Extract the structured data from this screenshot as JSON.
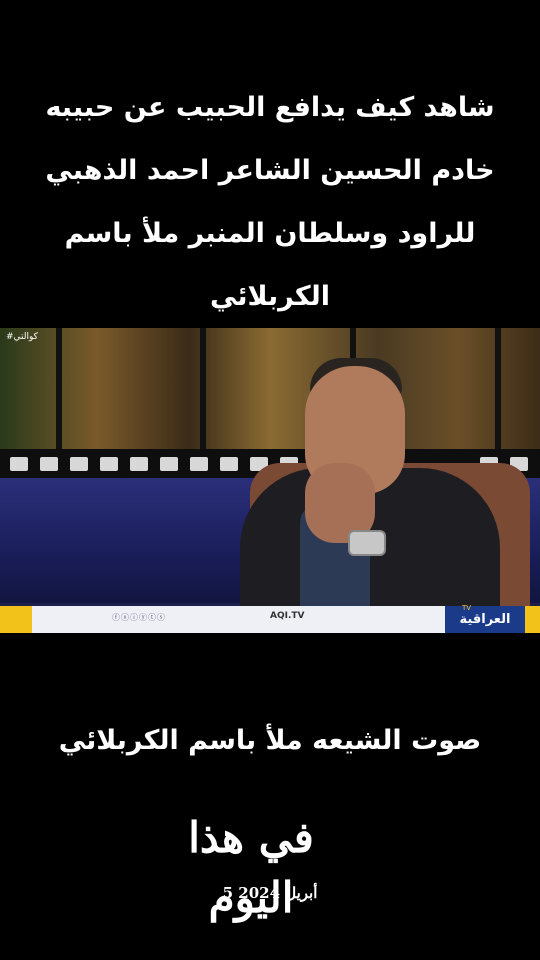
{
  "top_caption": {
    "lines": [
      "شاهد كيف يدافع الحبيب عن حبيبه",
      "خادم الحسين الشاعر احمد الذهبي",
      "للراود وسلطان المنبر ملأ باسم",
      "الكربلائي"
    ]
  },
  "video": {
    "tag": "#كوالتي",
    "ticker": {
      "url": "AQI.TV",
      "social": "ⓕⓧⓘⓨⓣⓢ",
      "logo": "العراقية",
      "logo_badge": "TV"
    }
  },
  "bottom_caption": "صوت الشيعه ملأ باسم الكربلائي",
  "title_art": "في هذا اليوم",
  "date": "5 أبريل 2024",
  "colors": {
    "background": "#000000",
    "ticker_yellow": "#f3c21a",
    "logo_blue": "#1b3a8a"
  }
}
